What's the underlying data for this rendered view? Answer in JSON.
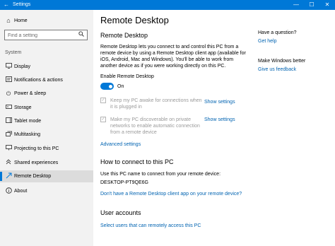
{
  "window": {
    "title": "Settings",
    "back_icon": "back-arrow-icon",
    "minimize_glyph": "—",
    "maximize_glyph": "☐",
    "close_glyph": "✕"
  },
  "sidebar": {
    "home_label": "Home",
    "search_placeholder": "Find a setting",
    "group_label": "System",
    "items": [
      {
        "label": "Display",
        "icon": "display-icon"
      },
      {
        "label": "Notifications & actions",
        "icon": "notifications-icon"
      },
      {
        "label": "Power & sleep",
        "icon": "power-icon"
      },
      {
        "label": "Storage",
        "icon": "storage-icon"
      },
      {
        "label": "Tablet mode",
        "icon": "tablet-icon"
      },
      {
        "label": "Multitasking",
        "icon": "multitasking-icon"
      },
      {
        "label": "Projecting to this PC",
        "icon": "projecting-icon"
      },
      {
        "label": "Shared experiences",
        "icon": "shared-icon"
      },
      {
        "label": "Remote Desktop",
        "icon": "remote-desktop-icon",
        "selected": true
      },
      {
        "label": "About",
        "icon": "about-icon"
      }
    ]
  },
  "main": {
    "title": "Remote Desktop",
    "section1": {
      "heading": "Remote Desktop",
      "description": "Remote Desktop lets you connect to and control this PC from a remote device by using a Remote Desktop client app (available for iOS, Android, Mac and Windows). You'll be able to work from another device as if you were working directly on this PC.",
      "toggle_label": "Enable Remote Desktop",
      "toggle_state": "On",
      "option1": "Keep my PC awake for connections when it is plugged in",
      "option2": "Make my PC discoverable on private networks to enable automatic connection from a remote device",
      "show_settings": "Show settings",
      "check_glyph": "✓",
      "advanced_link": "Advanced settings"
    },
    "section2": {
      "heading": "How to connect to this PC",
      "instruction": "Use this PC name to connect from your remote device:",
      "pc_name": "DESKTOP-PT9QE6G",
      "app_link": "Don't have a Remote Desktop client app on your remote device?"
    },
    "section3": {
      "heading": "User accounts",
      "link": "Select users that can remotely access this PC"
    }
  },
  "aside": {
    "question_heading": "Have a question?",
    "help_link": "Get help",
    "better_heading": "Make Windows better",
    "feedback_link": "Give us feedback"
  },
  "colors": {
    "accent": "#0078d7",
    "link": "#0063b1",
    "sidebar_bg": "#f2f2f2"
  }
}
